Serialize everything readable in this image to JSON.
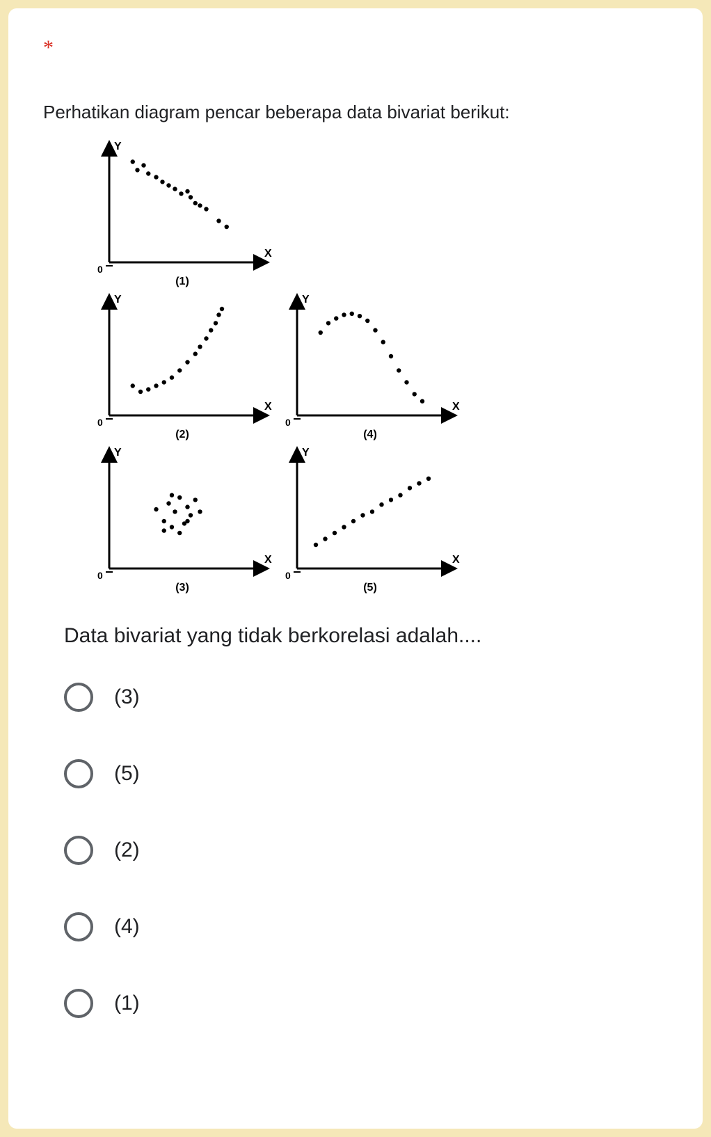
{
  "required_marker": "*",
  "question": {
    "intro": "Perhatikan diagram pencar beberapa data bivariat berikut:",
    "followup": "Data bivariat yang tidak berkorelasi adalah...."
  },
  "diagrams": [
    {
      "label": "(1)",
      "x_label": "X",
      "y_label": "Y",
      "origin": "0"
    },
    {
      "label": "(2)",
      "x_label": "X",
      "y_label": "Y",
      "origin": "0"
    },
    {
      "label": "(3)",
      "x_label": "X",
      "y_label": "Y",
      "origin": "0"
    },
    {
      "label": "(4)",
      "x_label": "X",
      "y_label": "Y",
      "origin": "0"
    },
    {
      "label": "(5)",
      "x_label": "X",
      "y_label": "Y",
      "origin": "0"
    }
  ],
  "chart_data": [
    {
      "type": "scatter",
      "label": "(1)",
      "description": "negative linear correlation",
      "points": [
        {
          "x": 15,
          "y": 85
        },
        {
          "x": 18,
          "y": 78
        },
        {
          "x": 22,
          "y": 82
        },
        {
          "x": 25,
          "y": 75
        },
        {
          "x": 30,
          "y": 72
        },
        {
          "x": 34,
          "y": 68
        },
        {
          "x": 38,
          "y": 65
        },
        {
          "x": 42,
          "y": 62
        },
        {
          "x": 46,
          "y": 58
        },
        {
          "x": 50,
          "y": 60
        },
        {
          "x": 52,
          "y": 55
        },
        {
          "x": 55,
          "y": 50
        },
        {
          "x": 58,
          "y": 48
        },
        {
          "x": 62,
          "y": 45
        },
        {
          "x": 70,
          "y": 35
        },
        {
          "x": 75,
          "y": 30
        }
      ],
      "xlabel": "X",
      "ylabel": "Y"
    },
    {
      "type": "scatter",
      "label": "(2)",
      "description": "positive nonlinear (increasing curve)",
      "points": [
        {
          "x": 15,
          "y": 25
        },
        {
          "x": 20,
          "y": 20
        },
        {
          "x": 25,
          "y": 22
        },
        {
          "x": 30,
          "y": 25
        },
        {
          "x": 35,
          "y": 28
        },
        {
          "x": 40,
          "y": 32
        },
        {
          "x": 45,
          "y": 38
        },
        {
          "x": 50,
          "y": 45
        },
        {
          "x": 55,
          "y": 52
        },
        {
          "x": 58,
          "y": 58
        },
        {
          "x": 62,
          "y": 65
        },
        {
          "x": 65,
          "y": 72
        },
        {
          "x": 68,
          "y": 78
        },
        {
          "x": 70,
          "y": 85
        },
        {
          "x": 72,
          "y": 90
        }
      ],
      "xlabel": "X",
      "ylabel": "Y"
    },
    {
      "type": "scatter",
      "label": "(3)",
      "description": "no correlation (random cluster)",
      "points": [
        {
          "x": 30,
          "y": 50
        },
        {
          "x": 35,
          "y": 40
        },
        {
          "x": 38,
          "y": 55
        },
        {
          "x": 40,
          "y": 35
        },
        {
          "x": 42,
          "y": 48
        },
        {
          "x": 45,
          "y": 60
        },
        {
          "x": 48,
          "y": 38
        },
        {
          "x": 50,
          "y": 52
        },
        {
          "x": 52,
          "y": 45
        },
        {
          "x": 55,
          "y": 58
        },
        {
          "x": 45,
          "y": 30
        },
        {
          "x": 58,
          "y": 48
        },
        {
          "x": 40,
          "y": 62
        },
        {
          "x": 35,
          "y": 32
        },
        {
          "x": 50,
          "y": 40
        }
      ],
      "xlabel": "X",
      "ylabel": "Y"
    },
    {
      "type": "scatter",
      "label": "(4)",
      "description": "inverted-U (rise then fall)",
      "points": [
        {
          "x": 15,
          "y": 70
        },
        {
          "x": 20,
          "y": 78
        },
        {
          "x": 25,
          "y": 82
        },
        {
          "x": 30,
          "y": 85
        },
        {
          "x": 35,
          "y": 86
        },
        {
          "x": 40,
          "y": 84
        },
        {
          "x": 45,
          "y": 80
        },
        {
          "x": 50,
          "y": 72
        },
        {
          "x": 55,
          "y": 62
        },
        {
          "x": 60,
          "y": 50
        },
        {
          "x": 65,
          "y": 38
        },
        {
          "x": 70,
          "y": 28
        },
        {
          "x": 75,
          "y": 18
        },
        {
          "x": 80,
          "y": 12
        }
      ],
      "xlabel": "X",
      "ylabel": "Y"
    },
    {
      "type": "scatter",
      "label": "(5)",
      "description": "positive linear correlation",
      "points": [
        {
          "x": 12,
          "y": 20
        },
        {
          "x": 18,
          "y": 25
        },
        {
          "x": 24,
          "y": 30
        },
        {
          "x": 30,
          "y": 35
        },
        {
          "x": 36,
          "y": 40
        },
        {
          "x": 42,
          "y": 45
        },
        {
          "x": 48,
          "y": 48
        },
        {
          "x": 54,
          "y": 54
        },
        {
          "x": 60,
          "y": 58
        },
        {
          "x": 66,
          "y": 62
        },
        {
          "x": 72,
          "y": 68
        },
        {
          "x": 78,
          "y": 72
        },
        {
          "x": 84,
          "y": 76
        }
      ],
      "xlabel": "X",
      "ylabel": "Y"
    }
  ],
  "options": [
    {
      "label": "(3)"
    },
    {
      "label": "(5)"
    },
    {
      "label": "(2)"
    },
    {
      "label": "(4)"
    },
    {
      "label": "(1)"
    }
  ]
}
